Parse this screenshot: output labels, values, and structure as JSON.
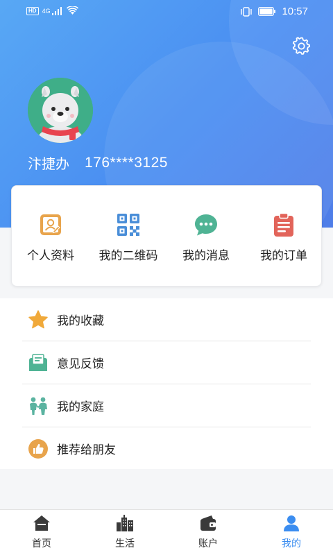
{
  "status_bar": {
    "hd": "HD",
    "network": "4G",
    "time": "10:57"
  },
  "header": {
    "settings_icon": "gear-icon",
    "avatar": "bear-avatar",
    "username": "汴捷办",
    "phone": "176****3125"
  },
  "quick_actions": [
    {
      "label": "个人资料",
      "icon": "profile-card-icon",
      "color": "#e8a44c"
    },
    {
      "label": "我的二维码",
      "icon": "qr-code-icon",
      "color": "#4a8ed8"
    },
    {
      "label": "我的消息",
      "icon": "chat-bubble-icon",
      "color": "#4fb394"
    },
    {
      "label": "我的订单",
      "icon": "clipboard-icon",
      "color": "#e2645a"
    }
  ],
  "menu": [
    {
      "label": "我的收藏",
      "icon": "star-icon",
      "color": "#f0a93a"
    },
    {
      "label": "意见反馈",
      "icon": "feedback-envelope-icon",
      "color": "#4fb394"
    },
    {
      "label": "我的家庭",
      "icon": "family-icon",
      "color": "#5ab3a0"
    },
    {
      "label": "推荐给朋友",
      "icon": "thumbs-up-icon",
      "color": "#e8a44c"
    }
  ],
  "tabbar": [
    {
      "label": "首页",
      "icon": "home-icon",
      "active": false
    },
    {
      "label": "生活",
      "icon": "city-icon",
      "active": false
    },
    {
      "label": "账户",
      "icon": "wallet-icon",
      "active": false
    },
    {
      "label": "我的",
      "icon": "person-icon",
      "active": true
    }
  ],
  "colors": {
    "header_gradient_start": "#58a8f4",
    "header_gradient_end": "#4f7de8",
    "active_tab": "#3b8df0"
  }
}
